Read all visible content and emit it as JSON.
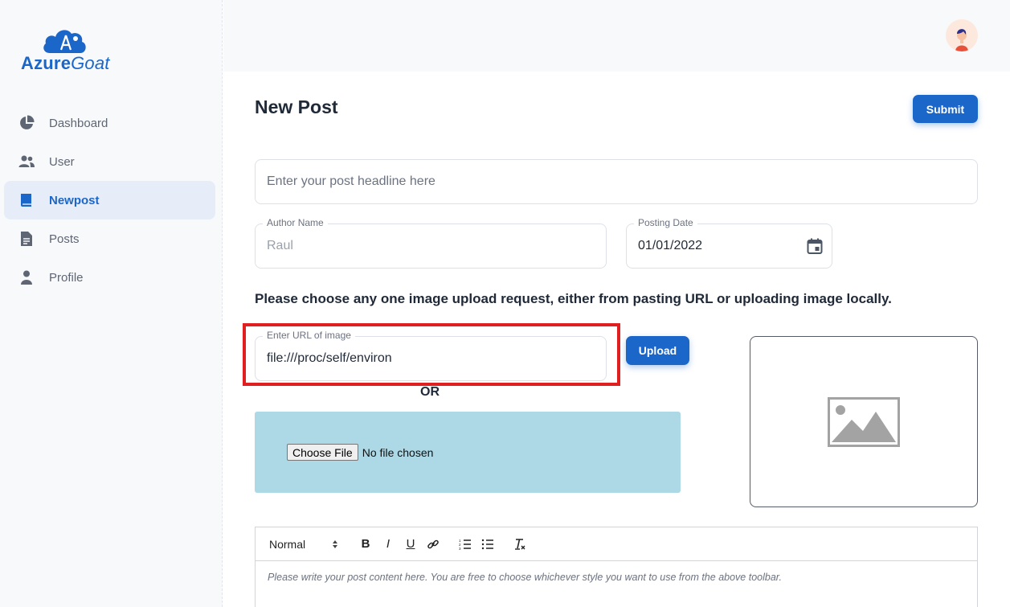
{
  "brand": {
    "name_main": "Azure",
    "name_accent": "Goat",
    "accent_color": "#1b66c9"
  },
  "sidebar": {
    "items": [
      {
        "label": "Dashboard",
        "icon": "pie-chart-icon",
        "active": false
      },
      {
        "label": "User",
        "icon": "users-icon",
        "active": false
      },
      {
        "label": "Newpost",
        "icon": "book-icon",
        "active": true
      },
      {
        "label": "Posts",
        "icon": "document-icon",
        "active": false
      },
      {
        "label": "Profile",
        "icon": "person-icon",
        "active": false
      }
    ]
  },
  "header": {
    "avatar": "user-avatar"
  },
  "main": {
    "title": "New Post",
    "submit_label": "Submit",
    "headline_placeholder": "Enter your post headline here",
    "author": {
      "legend": "Author Name",
      "value": "Raul"
    },
    "posting_date": {
      "legend": "Posting Date",
      "value": "01/01/2022"
    },
    "instruction": "Please choose any one image upload request, either from pasting URL or uploading image locally.",
    "url_field": {
      "legend": "Enter URL of image",
      "value": "file:///proc/self/environ"
    },
    "upload_label": "Upload",
    "or_label": "OR",
    "file_input": {
      "button": "Choose File",
      "status": "No file chosen"
    },
    "editor": {
      "format_select": "Normal",
      "tools": [
        "bold-icon",
        "italic-icon",
        "underline-icon",
        "link-icon",
        "ordered-list-icon",
        "bullet-list-icon",
        "clear-format-icon"
      ],
      "placeholder": "Please write your post content here. You are free to choose whichever style you want to use from the above toolbar."
    }
  },
  "colors": {
    "primary": "#1b66c9",
    "highlight_border": "#e02020",
    "dropzone": "#add8e6"
  }
}
